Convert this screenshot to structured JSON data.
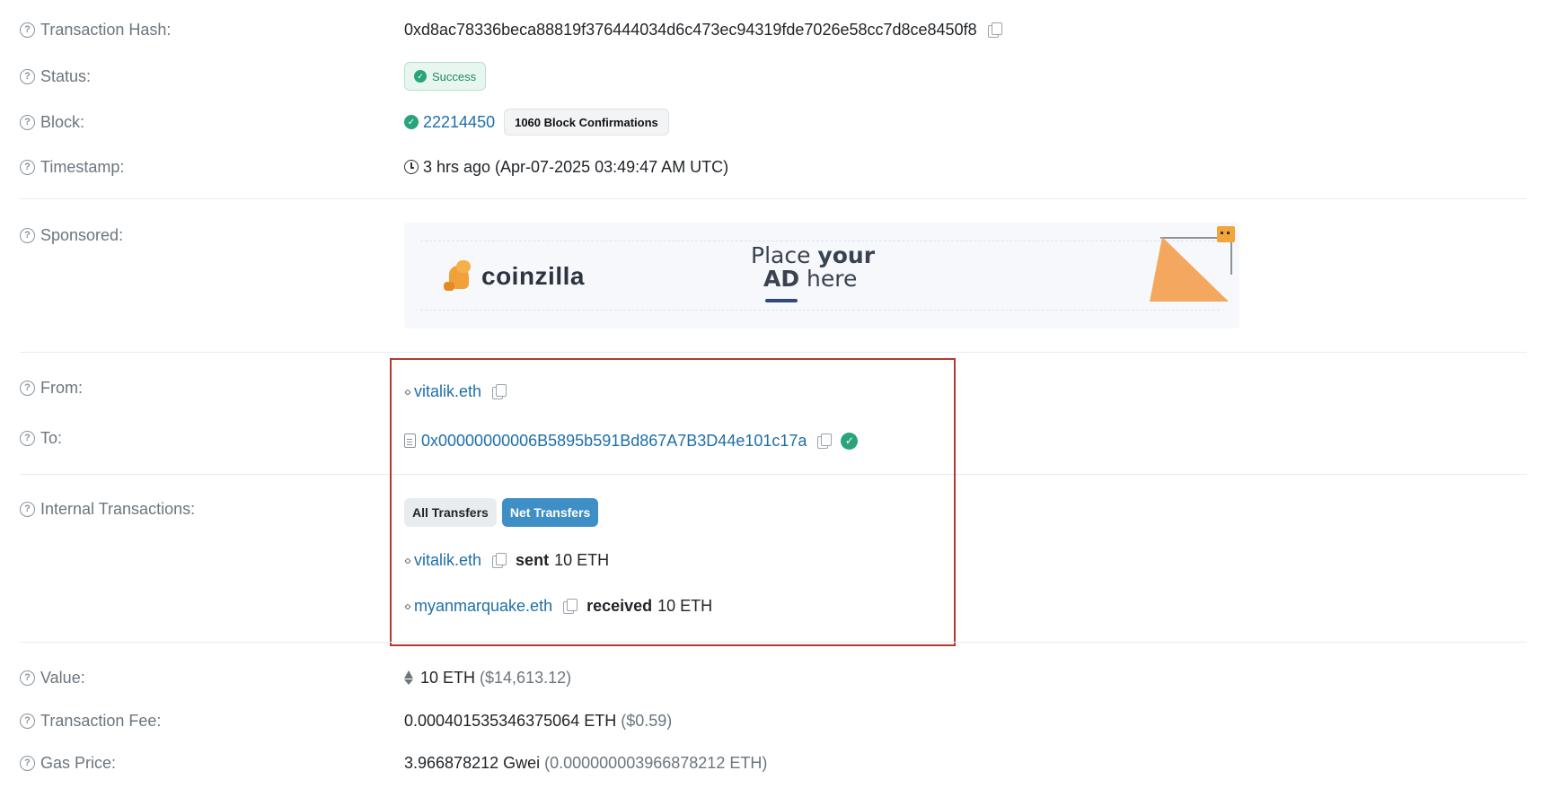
{
  "rows": {
    "hash": {
      "label": "Transaction Hash:",
      "value": "0xd8ac78336beca88819f376444034d6c473ec94319fde7026e58cc7d8ce8450f8"
    },
    "status": {
      "label": "Status:",
      "value": "Success"
    },
    "block": {
      "label": "Block:",
      "number": "22214450",
      "confirmations": "1060 Block Confirmations"
    },
    "timestamp": {
      "label": "Timestamp:",
      "value": "3 hrs ago (Apr-07-2025 03:49:47 AM UTC)"
    },
    "sponsored": {
      "label": "Sponsored:"
    },
    "from": {
      "label": "From:",
      "value": "vitalik.eth"
    },
    "to": {
      "label": "To:",
      "value": "0x00000000006B5895b591Bd867A7B3D44e101c17a"
    },
    "internal": {
      "label": "Internal Transactions:",
      "tabs": [
        "All Transfers",
        "Net Transfers"
      ],
      "entries": [
        {
          "address": "vitalik.eth",
          "action": "sent",
          "amount": "10 ETH"
        },
        {
          "address": "myanmarquake.eth",
          "action": "received",
          "amount": "10 ETH"
        }
      ]
    },
    "value": {
      "label": "Value:",
      "amount": "10 ETH",
      "usd": "($14,613.12)"
    },
    "fee": {
      "label": "Transaction Fee:",
      "amount": "0.000401535346375064 ETH",
      "usd": "($0.59)"
    },
    "gas": {
      "label": "Gas Price:",
      "amount": "3.966878212 Gwei",
      "eth": "(0.000000003966878212 ETH)"
    }
  },
  "ad": {
    "brand": "coinzilla",
    "line1_a": "Place ",
    "line1_b": "your",
    "line2_a": "AD",
    "line2_b": " here"
  },
  "colors": {
    "link": "#1e6fa8",
    "success": "#2aa47a",
    "highlight": "#b23a2e",
    "active_tab": "#3f8fc7"
  }
}
